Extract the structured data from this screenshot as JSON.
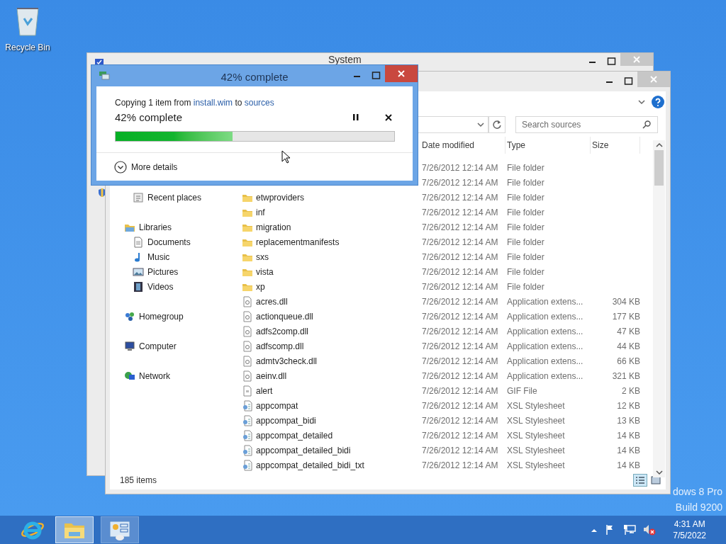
{
  "desktop_icons": [
    {
      "label": "Recycle Bin"
    }
  ],
  "back_window": {
    "title": "System"
  },
  "explorer": {
    "search": {
      "placeholder": "Search sources"
    },
    "columns": [
      "Date modified",
      "Type",
      "Size"
    ],
    "nav": [
      {
        "children": [
          {
            "label": "Recent places",
            "kind": "recent"
          }
        ]
      },
      {
        "label": "Libraries",
        "kind": "library",
        "children": [
          {
            "label": "Documents",
            "kind": "document"
          },
          {
            "label": "Music",
            "kind": "music"
          },
          {
            "label": "Pictures",
            "kind": "picture"
          },
          {
            "label": "Videos",
            "kind": "video"
          }
        ]
      },
      {
        "label": "Homegroup",
        "kind": "homegroup"
      },
      {
        "label": "Computer",
        "kind": "computer"
      },
      {
        "label": "Network",
        "kind": "network"
      }
    ],
    "rows": [
      {
        "date": "7/26/2012 12:14 AM",
        "type": "File folder"
      },
      {
        "date": "7/26/2012 12:14 AM",
        "type": "File folder"
      },
      {
        "kind": "folder",
        "name": "etwproviders",
        "date": "7/26/2012 12:14 AM",
        "type": "File folder"
      },
      {
        "kind": "folder",
        "name": "inf",
        "date": "7/26/2012 12:14 AM",
        "type": "File folder"
      },
      {
        "kind": "folder",
        "name": "migration",
        "date": "7/26/2012 12:14 AM",
        "type": "File folder"
      },
      {
        "kind": "folder",
        "name": "replacementmanifests",
        "date": "7/26/2012 12:14 AM",
        "type": "File folder"
      },
      {
        "kind": "folder",
        "name": "sxs",
        "date": "7/26/2012 12:14 AM",
        "type": "File folder"
      },
      {
        "kind": "folder",
        "name": "vista",
        "date": "7/26/2012 12:14 AM",
        "type": "File folder"
      },
      {
        "kind": "folder",
        "name": "xp",
        "date": "7/26/2012 12:14 AM",
        "type": "File folder"
      },
      {
        "kind": "dll",
        "name": "acres.dll",
        "date": "7/26/2012 12:14 AM",
        "type": "Application extens...",
        "size": "304 KB"
      },
      {
        "kind": "dll",
        "name": "actionqueue.dll",
        "date": "7/26/2012 12:14 AM",
        "type": "Application extens...",
        "size": "177 KB"
      },
      {
        "kind": "dll",
        "name": "adfs2comp.dll",
        "date": "7/26/2012 12:14 AM",
        "type": "Application extens...",
        "size": "47 KB"
      },
      {
        "kind": "dll",
        "name": "adfscomp.dll",
        "date": "7/26/2012 12:14 AM",
        "type": "Application extens...",
        "size": "44 KB"
      },
      {
        "kind": "dll",
        "name": "admtv3check.dll",
        "date": "7/26/2012 12:14 AM",
        "type": "Application extens...",
        "size": "66 KB"
      },
      {
        "kind": "dll",
        "name": "aeinv.dll",
        "date": "7/26/2012 12:14 AM",
        "type": "Application extens...",
        "size": "321 KB"
      },
      {
        "kind": "gif",
        "name": "alert",
        "date": "7/26/2012 12:14 AM",
        "type": "GIF File",
        "size": "2 KB"
      },
      {
        "kind": "xsl",
        "name": "appcompat",
        "date": "7/26/2012 12:14 AM",
        "type": "XSL Stylesheet",
        "size": "12 KB"
      },
      {
        "kind": "xsl",
        "name": "appcompat_bidi",
        "date": "7/26/2012 12:14 AM",
        "type": "XSL Stylesheet",
        "size": "13 KB"
      },
      {
        "kind": "xsl",
        "name": "appcompat_detailed",
        "date": "7/26/2012 12:14 AM",
        "type": "XSL Stylesheet",
        "size": "14 KB"
      },
      {
        "kind": "xsl",
        "name": "appcompat_detailed_bidi",
        "date": "7/26/2012 12:14 AM",
        "type": "XSL Stylesheet",
        "size": "14 KB"
      },
      {
        "kind": "xsl",
        "name": "appcompat_detailed_bidi_txt",
        "date": "7/26/2012 12:14 AM",
        "type": "XSL Stylesheet",
        "size": "14 KB"
      }
    ],
    "status": "185 items",
    "views": [
      {
        "kind": "details",
        "selected": true
      },
      {
        "kind": "large",
        "selected": false
      }
    ]
  },
  "copy_dialog": {
    "title": "42% complete",
    "message_parts": [
      "Copying 1 item from",
      "install.wim",
      "to",
      "sources"
    ],
    "progress_text": "42% complete",
    "level": 0.42,
    "more": "More details"
  },
  "watermark_lines": [
    "dows 8 Pro",
    "Build 9200"
  ],
  "taskbar": {
    "apps": [
      {
        "kind": "ie",
        "selected": false
      },
      {
        "kind": "explorer",
        "selected": true
      },
      {
        "kind": "control",
        "selected": false
      }
    ],
    "time": "4:31 AM",
    "date": "7/5/2022"
  }
}
